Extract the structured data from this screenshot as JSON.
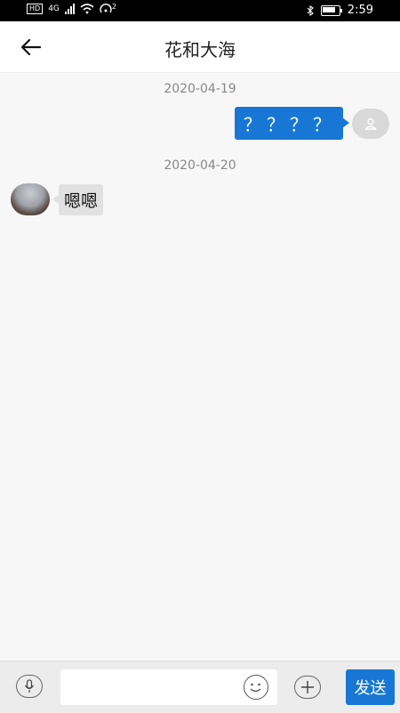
{
  "status_bar": {
    "network": "4G",
    "sim": "2",
    "time": "2:59",
    "hd_label": "HD"
  },
  "header": {
    "title": "花和大海"
  },
  "messages": [
    {
      "date": "2020-04-19",
      "direction": "outgoing",
      "text": "？？？？"
    },
    {
      "date": "2020-04-20",
      "direction": "incoming",
      "text": "嗯嗯"
    }
  ],
  "input_bar": {
    "placeholder": "",
    "send_label": "发送"
  },
  "colors": {
    "accent": "#1877d4",
    "incoming_bubble": "#e1e1e1",
    "background": "#f7f7f7"
  },
  "icons": [
    "back-arrow-icon",
    "mic-icon",
    "emoji-icon",
    "plus-icon",
    "avatar-placeholder-icon"
  ]
}
